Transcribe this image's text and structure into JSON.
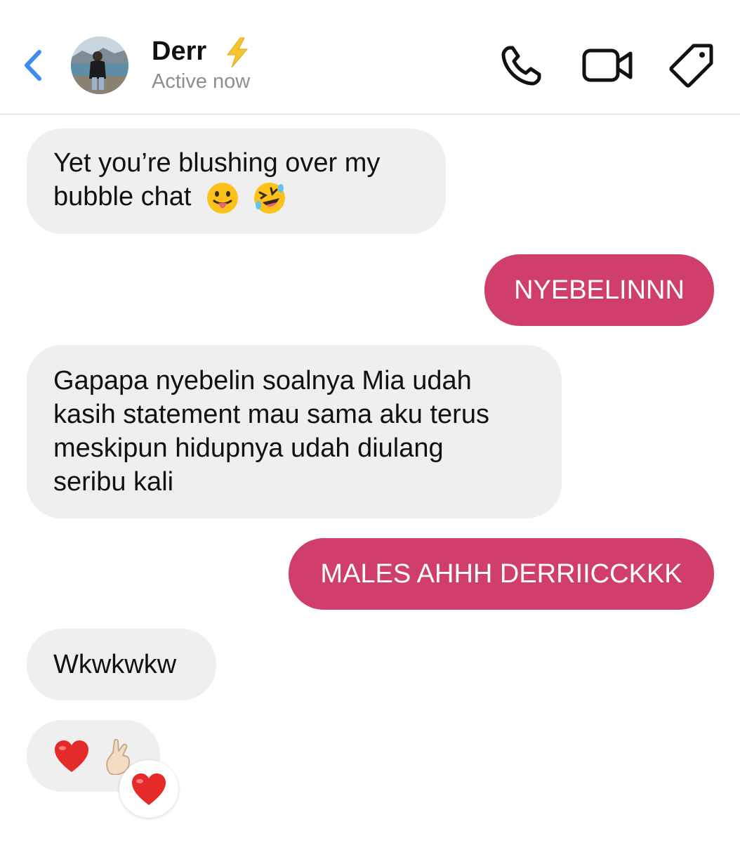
{
  "header": {
    "back_icon": "chevron-left-icon",
    "contact_name": "Derr",
    "name_badge_icon": "lightning-bolt-icon",
    "status": "Active now",
    "actions": [
      {
        "icon": "phone-icon"
      },
      {
        "icon": "video-camera-icon"
      },
      {
        "icon": "tag-icon"
      }
    ]
  },
  "messages": [
    {
      "direction": "incoming",
      "lines": [
        "Yet you’re blushing over my",
        "bubble chat"
      ],
      "emojis": [
        "tongue-face-emoji",
        "rolling-laughing-emoji"
      ]
    },
    {
      "direction": "outgoing",
      "text": "NYEBELINNN"
    },
    {
      "direction": "incoming",
      "lines": [
        "Gapapa nyebelin soalnya Mia udah",
        "kasih statement mau sama aku terus",
        "meskipun hidupnya udah diulang",
        "seribu kali"
      ]
    },
    {
      "direction": "outgoing",
      "text": "MALES AHHH DERRIICCKKK"
    },
    {
      "direction": "incoming",
      "text": "Wkwkwkw"
    },
    {
      "direction": "incoming",
      "emojis": [
        "red-heart-emoji",
        "finger-heart-emoji"
      ],
      "reaction": "red-heart-emoji"
    }
  ],
  "colors": {
    "accent_blue": "#3b8df0",
    "outgoing_bubble": "#cf3f69",
    "incoming_bubble": "#efefef",
    "status_gray": "#8e8e93",
    "bolt_yellow": "#f7c431"
  }
}
